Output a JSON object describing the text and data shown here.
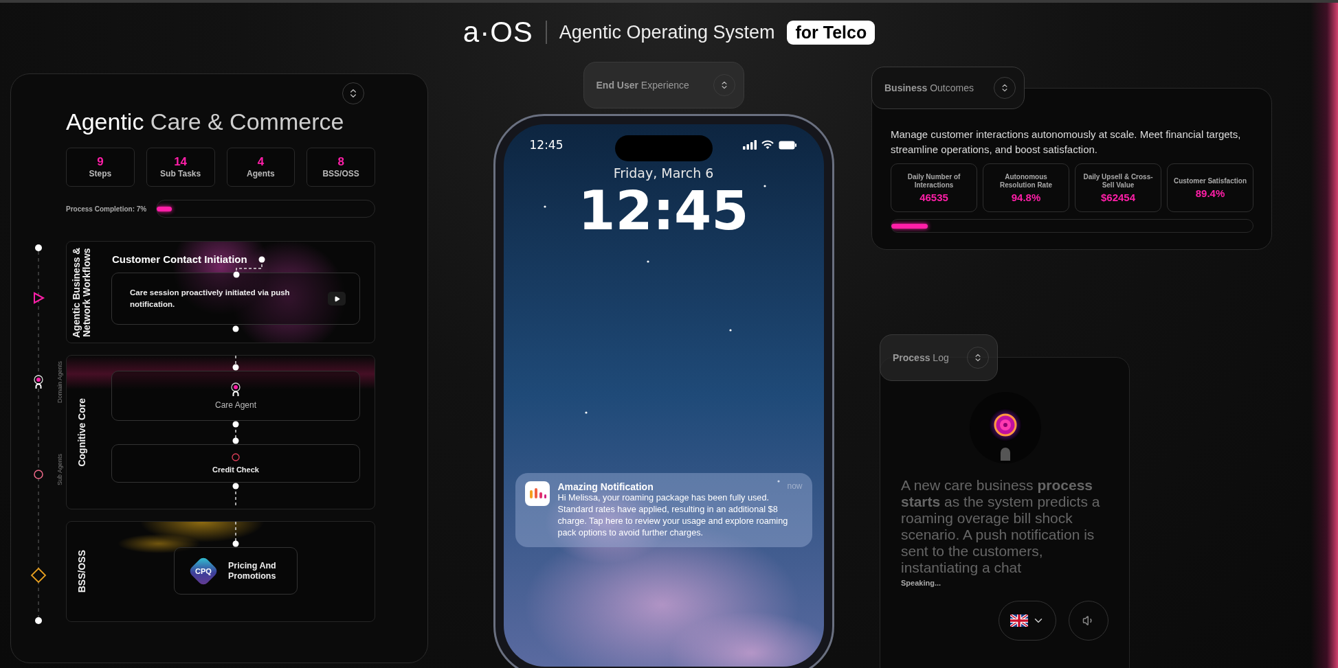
{
  "header": {
    "logo": "a·OS",
    "title": "Agentic Operating System",
    "badge": "for Telco"
  },
  "care_panel": {
    "title": "**Agentic** Care & Commerce",
    "stats": [
      {
        "value": "9",
        "label": "Steps"
      },
      {
        "value": "14",
        "label": "Sub Tasks"
      },
      {
        "value": "4",
        "label": "Agents"
      },
      {
        "value": "8",
        "label": "BSS/OSS"
      }
    ],
    "progress": {
      "label": "Process Completion: 7%",
      "level": 0.07
    },
    "rail_labels": [
      "Domain Agents",
      "Sub Agents"
    ],
    "sections": [
      {
        "kind": "workflow",
        "label": "Agentic Business & Network Workflows",
        "title": "Customer Contact Initiation",
        "card": "Care session proactively initiated via push notification."
      },
      {
        "kind": "agents",
        "label": "Cognitive Core",
        "agents": [
          {
            "kind": "domain",
            "name": "Care Agent"
          },
          {
            "kind": "sub",
            "name": "Credit Check"
          }
        ]
      },
      {
        "kind": "systems",
        "label": "BSS/OSS",
        "systems": [
          {
            "badge": "CPQ",
            "name": "Pricing And Promotions"
          }
        ]
      }
    ]
  },
  "phone": {
    "tab": "**End User** Experience",
    "status_time": "12:45",
    "date": "Friday, March 6",
    "clock": "12:45",
    "notification": {
      "app": "Amazing Notification",
      "time": "now",
      "body": "Hi Melissa, your roaming package has been fully used. Standard rates have applied, resulting in an additional $8 charge. Tap here to review your usage and explore roaming pack options to avoid further charges."
    }
  },
  "business_outcomes": {
    "tab": "**Business** Outcomes",
    "description": "Manage customer interactions autonomously at scale. Meet financial targets, streamline operations, and boost satisfaction.",
    "metrics": [
      {
        "label": "Daily Number of Interactions",
        "value": "46535"
      },
      {
        "label": "Autonomous Resolution Rate",
        "value": "94.8%"
      },
      {
        "label": "Daily Upsell & Cross-Sell Value",
        "value": "$62454"
      },
      {
        "label": "Customer Satisfaction",
        "value": "89.4%"
      }
    ],
    "progress": {
      "level": 0.1
    }
  },
  "process_log": {
    "tab": "**Process** Log",
    "text": "A new care business **process starts** as the system predicts a roaming overage bill shock scenario. A push notification is sent to the customers, instantiating a chat",
    "status": "Speaking..."
  }
}
